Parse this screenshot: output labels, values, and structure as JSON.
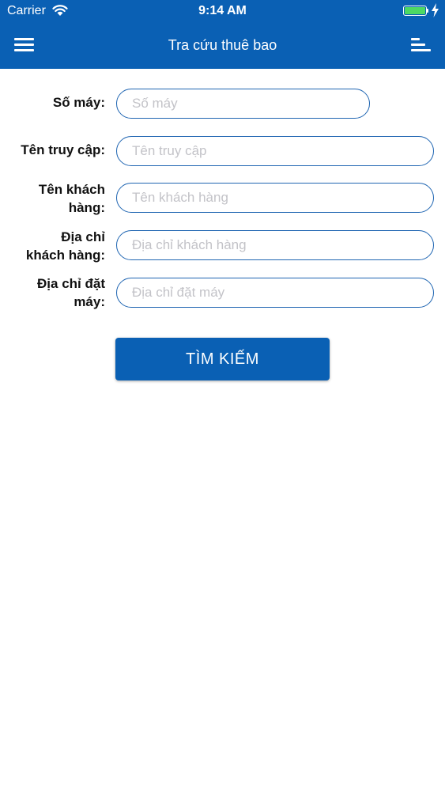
{
  "status_bar": {
    "carrier": "Carrier",
    "time": "9:14 AM",
    "battery_level_percent": 100,
    "battery_color": "#4cd964"
  },
  "nav_bar": {
    "title": "Tra cứu thuê bao",
    "background_color": "#0a60b4",
    "left_icon": "hamburger-menu-icon",
    "right_icon": "list-lines-icon"
  },
  "form": {
    "fields": [
      {
        "label": "Số máy:",
        "placeholder": "Số máy",
        "value": ""
      },
      {
        "label": "Tên truy cập:",
        "placeholder": "Tên truy cập",
        "value": ""
      },
      {
        "label_line1": "Tên khách",
        "label_line2": "hàng:",
        "placeholder": "Tên khách hàng",
        "value": ""
      },
      {
        "label_line1": "Địa chỉ",
        "label_line2": "khách hàng:",
        "placeholder": "Địa chỉ khách hàng",
        "value": ""
      },
      {
        "label_line1": "Địa chỉ đặt",
        "label_line2": "máy:",
        "placeholder": "Địa chỉ đặt máy",
        "value": ""
      }
    ],
    "submit_label": "TÌM KIẾM"
  }
}
